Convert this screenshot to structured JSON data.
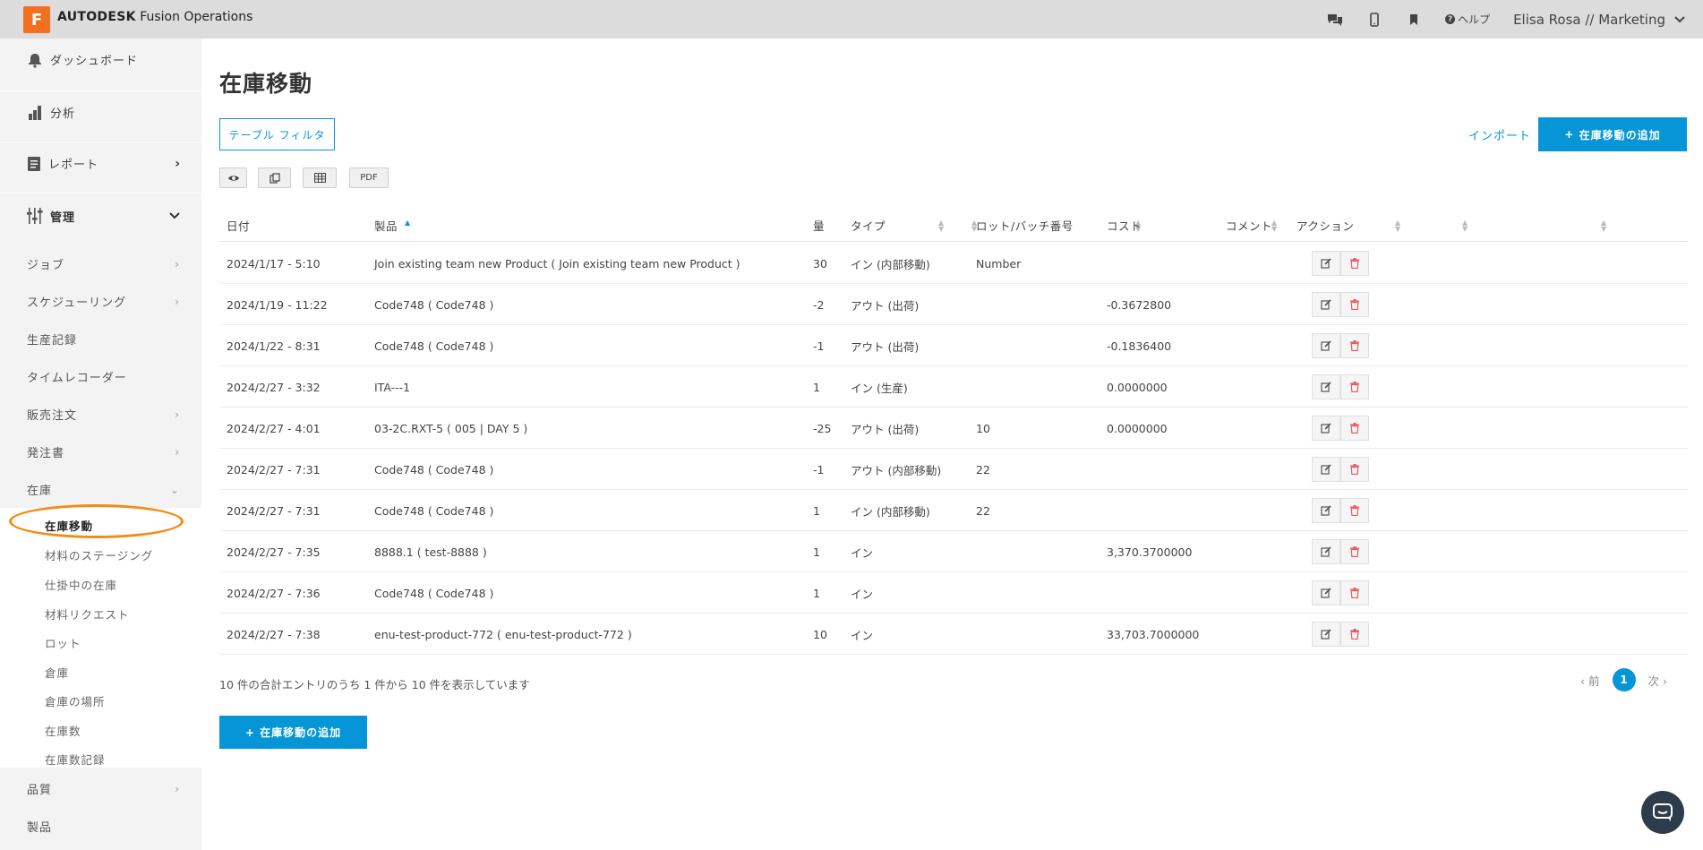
{
  "app": {
    "logo_letter": "F",
    "brand_bold": "AUTODESK",
    "brand_rest": "Fusion Operations",
    "help_label": "ヘルプ",
    "user": "Elisa Rosa // Marketing"
  },
  "sidebar": {
    "dashboard": "ダッシュボード",
    "analysis": "分析",
    "reports": "レポート",
    "management": "管理",
    "items": [
      {
        "label": "ジョブ"
      },
      {
        "label": "スケジューリング"
      },
      {
        "label": "生産記録"
      },
      {
        "label": "タイムレコーダー"
      },
      {
        "label": "販売注文"
      },
      {
        "label": "発注書"
      },
      {
        "label": "在庫"
      }
    ],
    "sub_items": [
      {
        "label": "在庫移動"
      },
      {
        "label": "材料のステージング"
      },
      {
        "label": "仕掛中の在庫"
      },
      {
        "label": "材料リクエスト"
      },
      {
        "label": "ロット"
      },
      {
        "label": "倉庫"
      },
      {
        "label": "倉庫の場所"
      },
      {
        "label": "在庫数"
      },
      {
        "label": "在庫数記録"
      }
    ],
    "bottom_items": [
      {
        "label": "品質"
      },
      {
        "label": "製品"
      }
    ]
  },
  "page": {
    "title": "在庫移動",
    "filter_button": "テーブル フィルタ",
    "import_link": "インポート",
    "add_button": "在庫移動の追加",
    "add_button_bottom": "在庫移動の追加",
    "tools": {
      "pdf": "PDF"
    }
  },
  "table": {
    "headers": {
      "date": "日付",
      "product": "製品",
      "qty": "量",
      "type": "タイプ",
      "lot": "ロット/バッチ番号",
      "cost": "コスト",
      "comment": "コメント",
      "action": "アクション"
    },
    "rows": [
      {
        "date": "2024/1/17 - 5:10",
        "product": "Join existing team new Product ( Join existing team new Product )",
        "qty": "30",
        "type": "イン (内部移動)",
        "lot": "Number",
        "cost": "",
        "comment": ""
      },
      {
        "date": "2024/1/19 - 11:22",
        "product": "Code748 ( Code748 )",
        "qty": "-2",
        "type": "アウト (出荷)",
        "lot": "",
        "cost": "-0.3672800",
        "comment": ""
      },
      {
        "date": "2024/1/22 - 8:31",
        "product": "Code748 ( Code748 )",
        "qty": "-1",
        "type": "アウト (出荷)",
        "lot": "",
        "cost": "-0.1836400",
        "comment": ""
      },
      {
        "date": "2024/2/27 - 3:32",
        "product": "ITA---1",
        "qty": "1",
        "type": "イン (生産)",
        "lot": "",
        "cost": "0.0000000",
        "comment": ""
      },
      {
        "date": "2024/2/27 - 4:01",
        "product": "03-2C.RXT-5 ( 005 | DAY 5 )",
        "qty": "-25",
        "type": "アウト (出荷)",
        "lot": "10",
        "cost": "0.0000000",
        "comment": ""
      },
      {
        "date": "2024/2/27 - 7:31",
        "product": "Code748 ( Code748 )",
        "qty": "-1",
        "type": "アウト (内部移動)",
        "lot": "22",
        "cost": "",
        "comment": ""
      },
      {
        "date": "2024/2/27 - 7:31",
        "product": "Code748 ( Code748 )",
        "qty": "1",
        "type": "イン (内部移動)",
        "lot": "22",
        "cost": "",
        "comment": ""
      },
      {
        "date": "2024/2/27 - 7:35",
        "product": "8888.1 ( test-8888 )",
        "qty": "1",
        "type": "イン",
        "lot": "",
        "cost": "3,370.3700000",
        "comment": ""
      },
      {
        "date": "2024/2/27 - 7:36",
        "product": "Code748 ( Code748 )",
        "qty": "1",
        "type": "イン",
        "lot": "",
        "cost": "",
        "comment": ""
      },
      {
        "date": "2024/2/27 - 7:38",
        "product": "enu-test-product-772 ( enu-test-product-772 )",
        "qty": "10",
        "type": "イン",
        "lot": "",
        "cost": "33,703.7000000",
        "comment": ""
      }
    ]
  },
  "footer": {
    "summary": "10 件の合計エントリのうち 1 件から 10 件を表示しています",
    "prev": "前",
    "page": "1",
    "next": "次"
  },
  "colors": {
    "accent": "#0696d7",
    "highlight": "#f58b12",
    "logo": "#f36f21",
    "delete": "#e8595f"
  }
}
